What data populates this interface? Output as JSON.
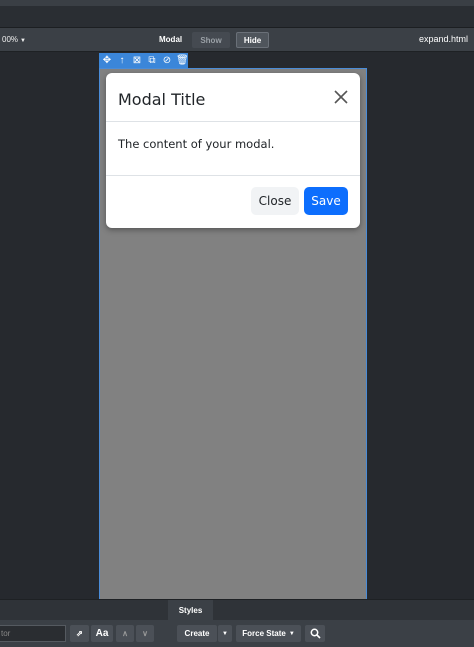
{
  "toolbar": {
    "zoom": "00%",
    "component_label": "Modal",
    "show_label": "Show",
    "hide_label": "Hide",
    "filename": "expand.html"
  },
  "selection_toolbar": {
    "icons": [
      "move-icon",
      "arrow-up-icon",
      "select-parent-icon",
      "copy-icon",
      "hide-icon",
      "delete-icon"
    ]
  },
  "modal": {
    "title": "Modal Title",
    "body": "The content of your modal.",
    "close_label": "Close",
    "save_label": "Save",
    "primary_color": "#0d6efd"
  },
  "bottom_panel": {
    "tab": "Styles",
    "selector_placeholder": "tor",
    "aa_label": "Aa",
    "create_label": "Create",
    "force_state_label": "Force State"
  }
}
